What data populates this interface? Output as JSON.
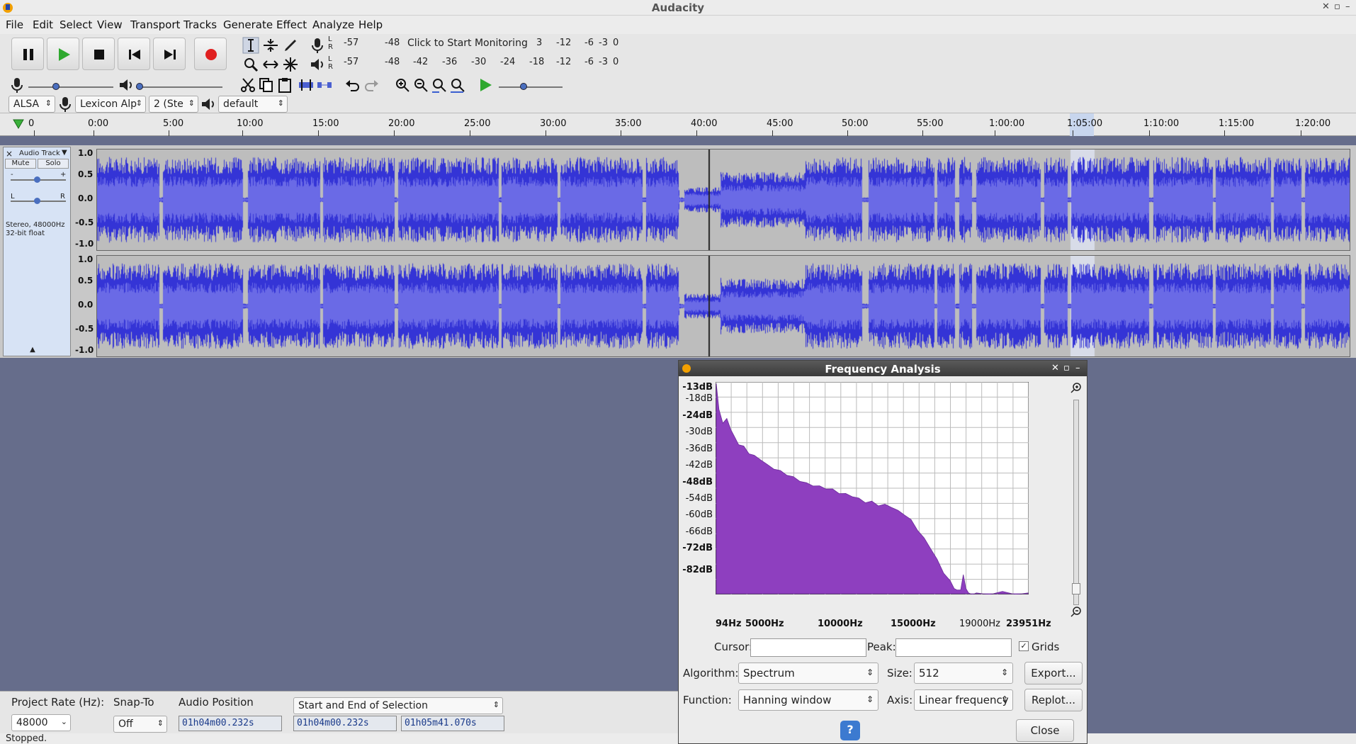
{
  "window": {
    "title": "Audacity"
  },
  "menu": [
    "File",
    "Edit",
    "Select",
    "View",
    "Transport",
    "Tracks",
    "Generate",
    "Effect",
    "Analyze",
    "Help"
  ],
  "meters": {
    "record_scale": [
      "-57",
      "-48",
      "Click to Start Monitoring",
      "3",
      "-12",
      "-6",
      "-3",
      "0"
    ],
    "play_scale": [
      "-57",
      "-48",
      "-42",
      "-36",
      "-30",
      "-24",
      "-18",
      "-12",
      "-6",
      "-3",
      "0"
    ],
    "L": "L",
    "R": "R"
  },
  "device": {
    "host": "ALSA",
    "input": "Lexicon Alp",
    "channels": "2 (Ste",
    "output": "default"
  },
  "ruler": {
    "labels": [
      "0",
      "0:00",
      "5:00",
      "10:00",
      "15:00",
      "20:00",
      "25:00",
      "30:00",
      "35:00",
      "40:00",
      "45:00",
      "50:00",
      "55:00",
      "1:00:00",
      "1:05:00",
      "1:10:00",
      "1:15:00",
      "1:20:00"
    ]
  },
  "track": {
    "name": "Audio Track",
    "mute": "Mute",
    "solo": "Solo",
    "close": "×",
    "gain_minus": "-",
    "gain_plus": "+",
    "pan_left": "L",
    "pan_right": "R",
    "info1": "Stereo, 48000Hz",
    "info2": "32-bit float",
    "scale": [
      "1.0",
      "0.5",
      "0.0",
      "-0.5",
      "-1.0"
    ]
  },
  "bottom": {
    "project_rate_label": "Project Rate (Hz):",
    "project_rate": "48000",
    "snap_label": "Snap-To",
    "snap_value": "Off",
    "audio_position_label": "Audio Position",
    "selection_mode": "Start and End of Selection",
    "audio_position": "01h04m00.232s",
    "sel_start": "01h04m00.232s",
    "sel_end": "01h05m41.070s"
  },
  "status": "Stopped.",
  "dialog": {
    "title": "Frequency Analysis",
    "cursor_label": "Cursor:",
    "peak_label": "Peak:",
    "grids_label": "Grids",
    "grids_checked": true,
    "algorithm_label": "Algorithm:",
    "algorithm": "Spectrum",
    "size_label": "Size:",
    "size": "512",
    "function_label": "Function:",
    "function": "Hanning window",
    "axis_label": "Axis:",
    "axis": "Linear frequency",
    "export": "Export...",
    "replot": "Replot...",
    "help": "?",
    "close": "Close"
  },
  "chart_data": {
    "type": "area",
    "title": "",
    "xlabel": "",
    "ylabel": "",
    "y_tick_labels": [
      "-13dB",
      "-18dB",
      "-24dB",
      "-30dB",
      "-36dB",
      "-42dB",
      "-48dB",
      "-54dB",
      "-60dB",
      "-66dB",
      "-72dB",
      "-82dB"
    ],
    "y_bold": [
      "-13dB",
      "-24dB",
      "-48dB",
      "-72dB",
      "-82dB"
    ],
    "x_tick_labels": [
      "94Hz",
      "5000Hz",
      "10000Hz",
      "15000Hz",
      "19000Hz",
      "23951Hz"
    ],
    "x_ticks_hz": [
      94,
      5000,
      10000,
      15000,
      19000,
      23951
    ],
    "xlim": [
      94,
      23951
    ],
    "ylim": [
      -82,
      -13
    ],
    "grid": true,
    "series": [
      {
        "color": "#8e3fbf",
        "x": [
          94,
          300,
          600,
          900,
          1200,
          1500,
          1800,
          2200,
          2600,
          3000,
          3500,
          4000,
          4500,
          5000,
          5500,
          6000,
          6500,
          7000,
          7500,
          8000,
          8500,
          9000,
          9500,
          10000,
          10500,
          11000,
          11500,
          12000,
          12500,
          13000,
          13500,
          14000,
          14500,
          15000,
          15500,
          16000,
          16500,
          17000,
          17500,
          18000,
          18300,
          18500,
          18800,
          19000,
          19200,
          19400,
          19700,
          20000,
          21000,
          22000,
          23000,
          23951
        ],
        "y": [
          -13,
          -22,
          -26,
          -25,
          -28,
          -31,
          -33,
          -34,
          -36,
          -37,
          -38,
          -40,
          -41,
          -42,
          -43,
          -44,
          -45,
          -46,
          -46.5,
          -47,
          -47.5,
          -48,
          -49,
          -49.5,
          -50,
          -51,
          -52,
          -52,
          -53,
          -53,
          -53.5,
          -55,
          -56,
          -58,
          -61,
          -64,
          -67,
          -71,
          -75,
          -78,
          -80,
          -81,
          -80.5,
          -76,
          -80,
          -82,
          -82,
          -82,
          -82,
          -81.5,
          -82,
          -82
        ]
      }
    ]
  },
  "colors": {
    "wave_dark": "#3434d6",
    "wave_light": "#6a6ae6",
    "spectrum": "#8e3fbf",
    "record": "#e02020",
    "play": "#2fa82f",
    "background": "#666d8b"
  }
}
